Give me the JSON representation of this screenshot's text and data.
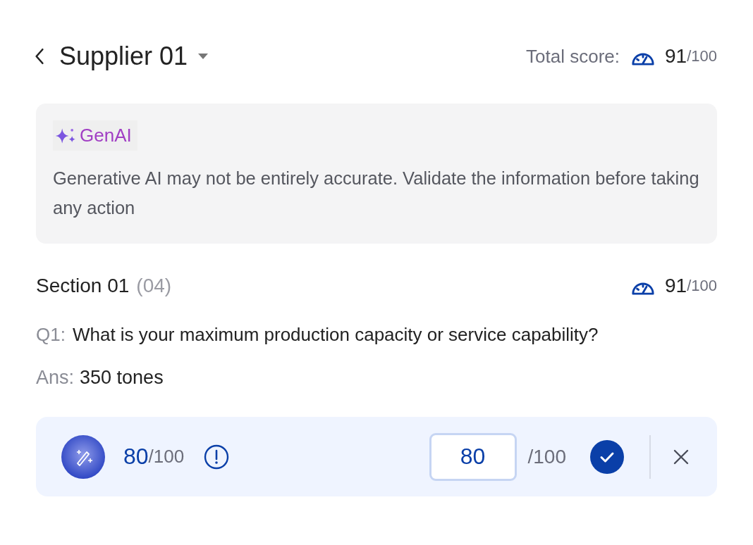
{
  "header": {
    "title": "Supplier 01",
    "total_label": "Total score:",
    "total_score": "91",
    "total_max": "/100"
  },
  "notice": {
    "badge": "GenAI",
    "text": "Generative AI may not be entirely accurate. Validate the information before taking any action"
  },
  "section": {
    "title": "Section 01",
    "count": "(04)",
    "score": "91",
    "max": "/100"
  },
  "question": {
    "label": "Q1:",
    "text": "What is your maximum production capacity or service capability?"
  },
  "answer": {
    "label": "Ans:",
    "text": "350 tones"
  },
  "scoring": {
    "ai_score": "80",
    "ai_max": "/100",
    "input_value": "80",
    "input_max": "/100"
  }
}
